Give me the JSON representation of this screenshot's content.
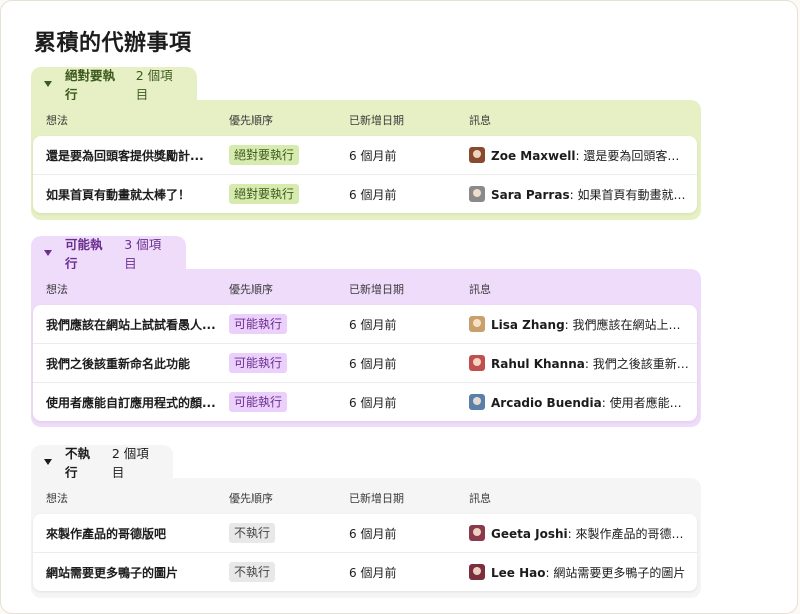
{
  "page": {
    "title": "累積的代辦事項"
  },
  "columns": {
    "idea": "想法",
    "priority": "優先順序",
    "added": "已新增日期",
    "message": "訊息"
  },
  "groups": [
    {
      "name": "絕對要執行",
      "count": "2 個項目",
      "colors": {
        "tab": "#e6f0c4",
        "body": "#e6f0c4",
        "text": "#3d5a1e",
        "pill_bg": "#d8ebae",
        "pill_text": "#3d5a1e"
      },
      "rows": [
        {
          "idea": "還是要為回頭客提供獎勵計...",
          "priority": "絕對要執行",
          "added": "6 個月前",
          "author": "Zoe Maxwell",
          "message": "還是要為回頭客提供...",
          "avatar_color": "#8a4a2e"
        },
        {
          "idea": "如果首頁有動畫就太棒了！",
          "priority": "絕對要執行",
          "added": "6 個月前",
          "author": "Sara Parras",
          "message": "如果首頁有動畫就太棒...",
          "avatar_color": "#8a8a8a"
        }
      ]
    },
    {
      "name": "可能執行",
      "count": "3 個項目",
      "colors": {
        "tab": "#efdcfb",
        "body": "#efdcfb",
        "text": "#6b2f8f",
        "pill_bg": "#ead0fa",
        "pill_text": "#6b2f8f"
      },
      "rows": [
        {
          "idea": "我們應該在網站上試試看愚人...",
          "priority": "可能執行",
          "added": "6 個月前",
          "author": "Lisa Zhang",
          "message": "我們應該在網站上試試...",
          "avatar_color": "#c9a06a"
        },
        {
          "idea": "我們之後該重新命名此功能",
          "priority": "可能執行",
          "added": "6 個月前",
          "author": "Rahul Khanna",
          "message": "我們之後該重新命名...",
          "avatar_color": "#c0504d"
        },
        {
          "idea": "使用者應能自訂應用程式的顏...",
          "priority": "可能執行",
          "added": "6 個月前",
          "author": "Arcadio Buendia",
          "message": "使用者應能自訂應...",
          "avatar_color": "#5a7fa8"
        }
      ]
    },
    {
      "name": "不執行",
      "count": "2 個項目",
      "colors": {
        "tab": "#f5f5f5",
        "body": "#f5f5f5",
        "text": "#1d1c1d",
        "pill_bg": "#e8e8e8",
        "pill_text": "#454545"
      },
      "rows": [
        {
          "idea": "來製作產品的哥德版吧",
          "priority": "不執行",
          "added": "6 個月前",
          "author": "Geeta Joshi",
          "message": "來製作產品的哥德版吧",
          "avatar_color": "#8a3a4a"
        },
        {
          "idea": "網站需要更多鴨子的圖片",
          "priority": "不執行",
          "added": "6 個月前",
          "author": "Lee Hao",
          "message": "網站需要更多鴨子的圖片",
          "avatar_color": "#7a2e3e"
        }
      ]
    }
  ]
}
